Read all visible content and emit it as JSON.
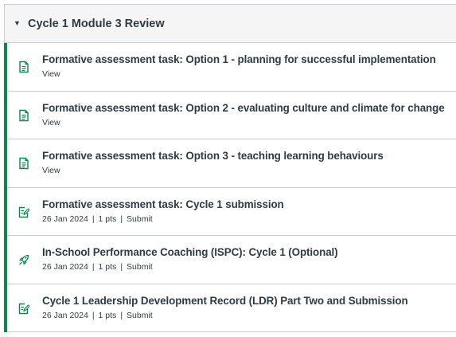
{
  "module": {
    "title": "Cycle 1 Module 3 Review",
    "collapse_icon": "caret-down-icon",
    "accent_color": "#0b874b",
    "items": [
      {
        "type": "page",
        "icon": "document-icon",
        "title": "Formative assessment task: Option 1 - planning for successful implementation",
        "action": "View"
      },
      {
        "type": "page",
        "icon": "document-icon",
        "title": "Formative assessment task: Option 2 - evaluating culture and climate for change",
        "action": "View"
      },
      {
        "type": "page",
        "icon": "document-icon",
        "title": "Formative assessment task: Option 3 - teaching learning behaviours",
        "action": "View"
      },
      {
        "type": "assignment",
        "icon": "assignment-edit-icon",
        "title": "Formative assessment task: Cycle 1 submission",
        "date": "26 Jan 2024",
        "points": "1 pts",
        "action": "Submit"
      },
      {
        "type": "external-tool",
        "icon": "rocket-icon",
        "title": "In-School Performance Coaching (ISPC): Cycle 1 (Optional)",
        "date": "26 Jan 2024",
        "points": "1 pts",
        "action": "Submit"
      },
      {
        "type": "assignment",
        "icon": "assignment-edit-icon",
        "title": "Cycle 1 Leadership Development Record (LDR) Part Two and Submission",
        "date": "26 Jan 2024",
        "points": "1 pts",
        "action": "Submit"
      }
    ]
  }
}
